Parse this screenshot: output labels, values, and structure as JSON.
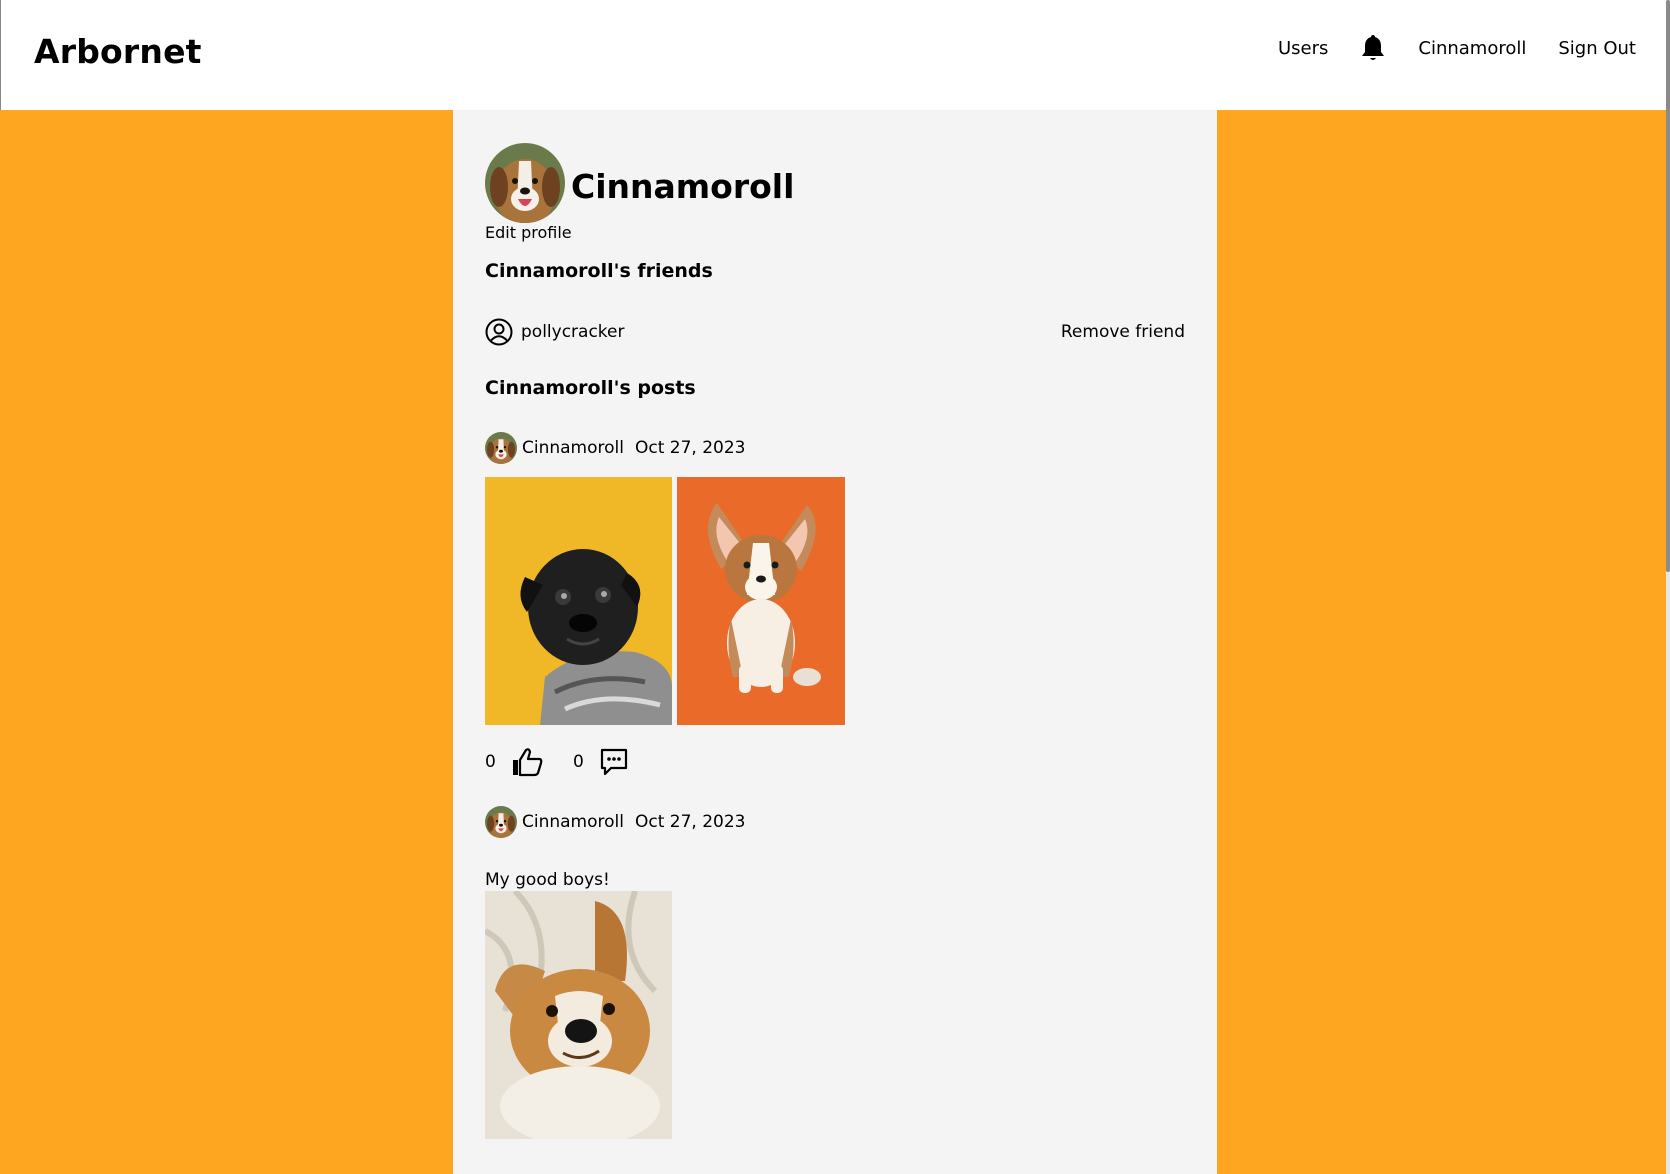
{
  "navbar": {
    "brand": "Arbornet",
    "links": {
      "users": "Users",
      "notifications_icon": "bell-icon",
      "profile": "Cinnamoroll",
      "sign_out": "Sign Out"
    }
  },
  "profile": {
    "name": "Cinnamoroll",
    "edit_label": "Edit profile",
    "friends_title": "Cinnamoroll's friends",
    "posts_title": "Cinnamoroll's posts"
  },
  "friends": [
    {
      "username": "pollycracker",
      "action": "Remove friend"
    }
  ],
  "posts": [
    {
      "author": "Cinnamoroll",
      "date": "Oct 27, 2023",
      "text": "",
      "images": [
        "black pug in knit sweater on yellow",
        "corgi puppy on orange"
      ],
      "likes": "0",
      "comments": "0"
    },
    {
      "author": "Cinnamoroll",
      "date": "Oct 27, 2023",
      "text": "My good boys!",
      "images": [
        "smiling golden dog on blanket"
      ]
    }
  ],
  "colors": {
    "page_bg": "#FFA621",
    "content_bg": "#F4F4F4",
    "navbar_bg": "#FFFFFF"
  }
}
